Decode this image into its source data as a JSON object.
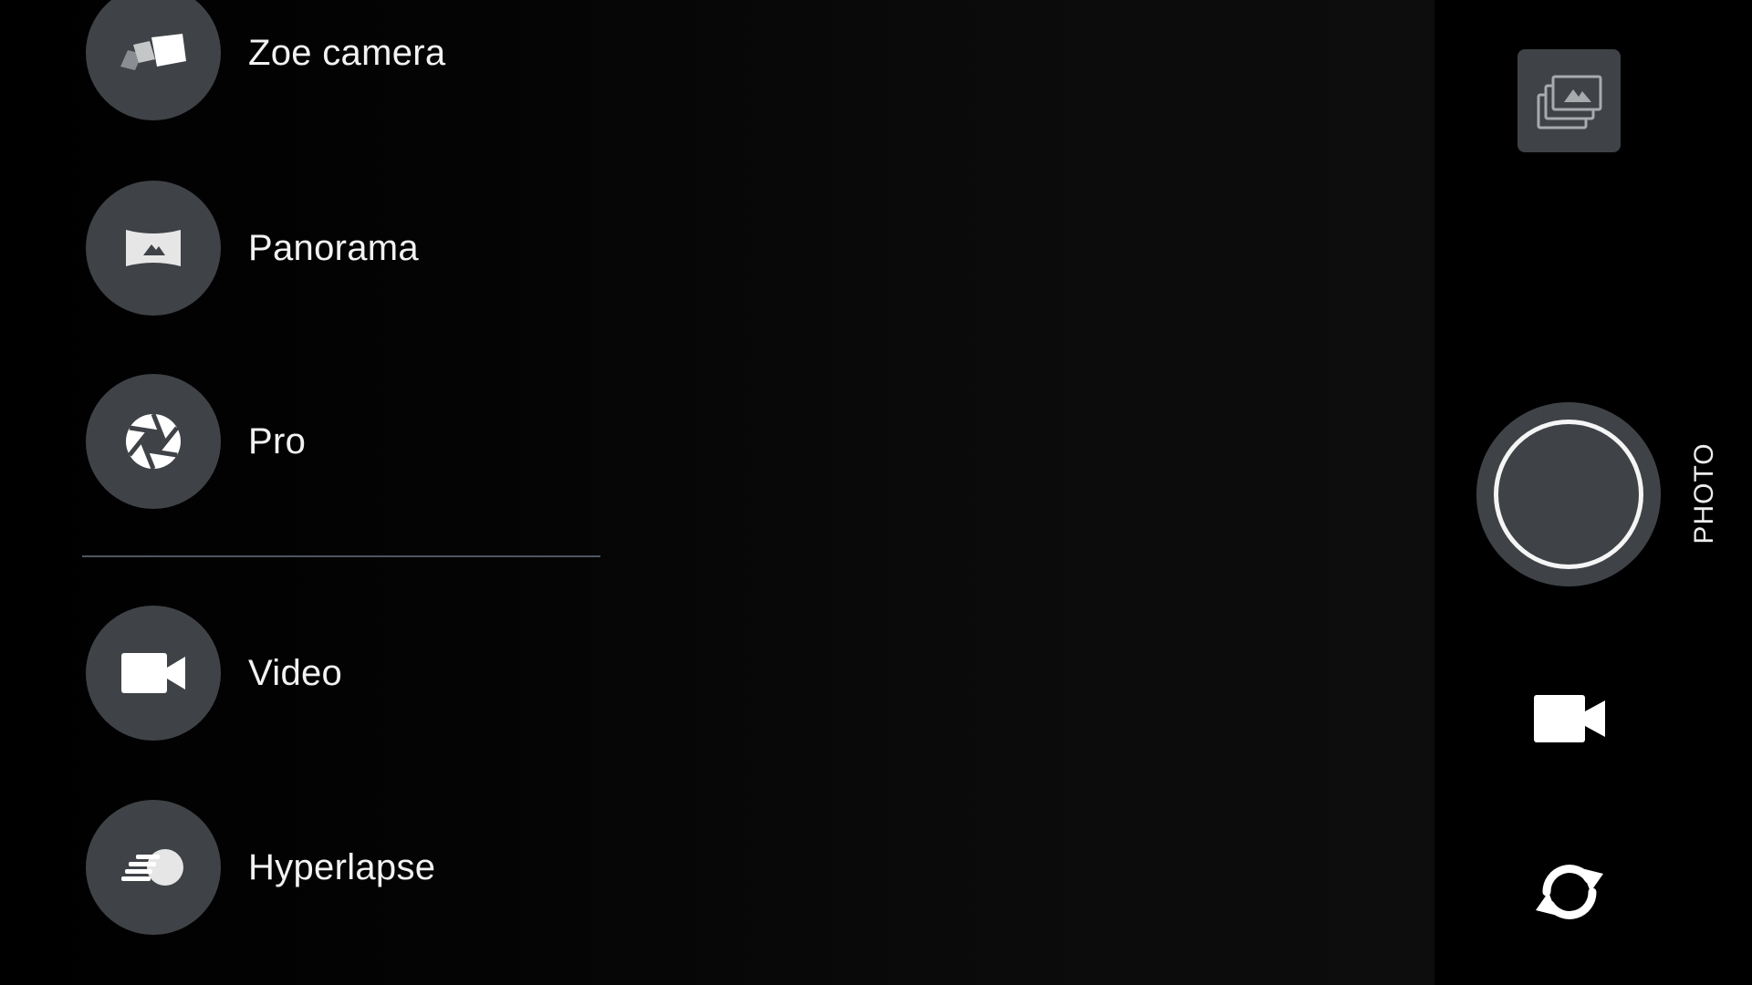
{
  "modes": [
    {
      "label": "Zoe camera",
      "icon": "zoe-camera-icon"
    },
    {
      "label": "Panorama",
      "icon": "panorama-icon"
    },
    {
      "label": "Pro",
      "icon": "aperture-icon"
    },
    {
      "label": "Video",
      "icon": "video-camera-icon"
    },
    {
      "label": "Hyperlapse",
      "icon": "hyperlapse-icon"
    }
  ],
  "current_mode_label": "PHOTO",
  "controls": {
    "gallery_icon": "gallery-icon",
    "shutter_icon": "shutter-button",
    "video_icon": "video-camera-icon",
    "switch_camera_icon": "switch-camera-icon"
  },
  "colors": {
    "background": "#000000",
    "button_fill": "#3f4246",
    "text": "#f2f2f2",
    "divider": "#4c5660"
  }
}
